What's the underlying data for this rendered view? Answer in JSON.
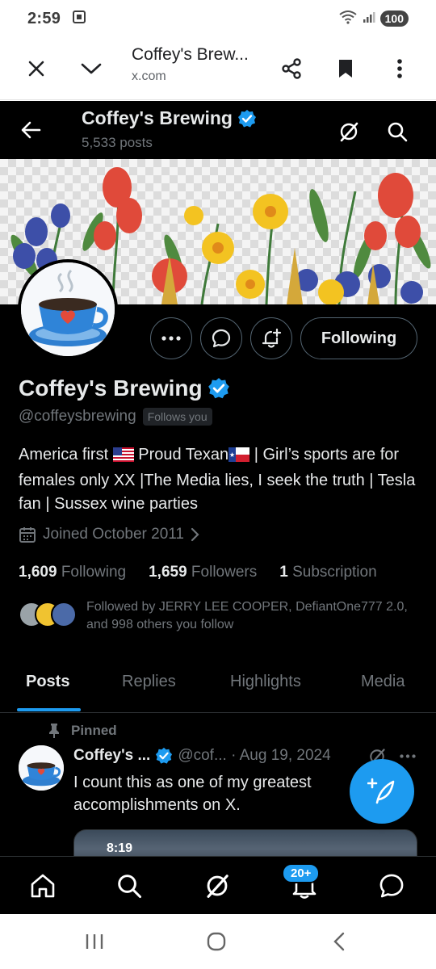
{
  "status_bar": {
    "time": "2:59",
    "battery": "100"
  },
  "browser": {
    "title": "Coffey's Brew...",
    "url": "x.com"
  },
  "header": {
    "name": "Coffey's Brewing",
    "posts_count": "5,533 posts"
  },
  "profile": {
    "following_button": "Following",
    "name": "Coffey's Brewing",
    "handle": "@coffeysbrewing",
    "follows_you": "Follows you",
    "bio": {
      "part1": "America first ",
      "part2": " Proud Texan",
      "part3": " | Girl’s sports are for females only XX |The Media lies, I seek the truth | Tesla fan | Sussex wine parties"
    },
    "joined": "Joined October 2011",
    "stats": {
      "following_num": "1,609",
      "following_label": "Following",
      "followers_num": "1,659",
      "followers_label": "Followers",
      "subs_num": "1",
      "subs_label": "Subscription"
    },
    "followed_by": "Followed by JERRY LEE COOPER, DefiantOne777 2.0, and 998 others you follow"
  },
  "tabs": [
    "Posts",
    "Replies",
    "Highlights",
    "Media"
  ],
  "pinned_post": {
    "pinned_label": "Pinned",
    "name": "Coffey's ...",
    "handle_date": "@cof... · Aug 19, 2024",
    "text": "I count this as one of my greatest accomplishments on X.",
    "media_time": "8:19"
  },
  "bottom_nav": {
    "notifications_badge": "20+"
  },
  "colors": {
    "accent": "#1d9bf0",
    "background": "#000000",
    "text_primary": "#e7e9ea",
    "text_secondary": "#71767b"
  }
}
